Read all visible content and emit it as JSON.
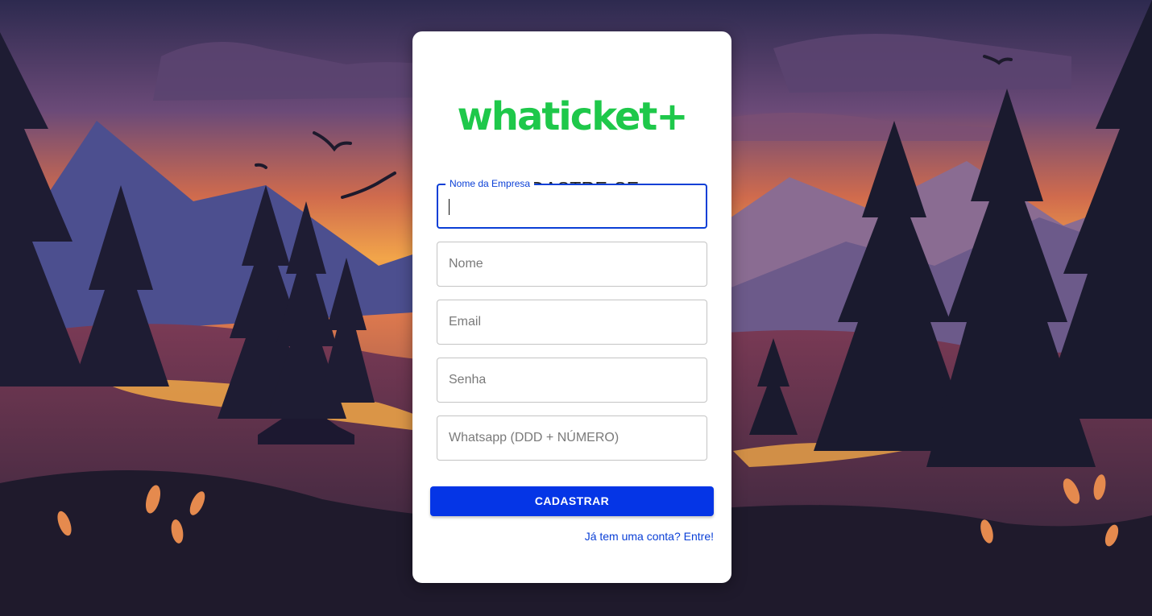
{
  "brand": {
    "logo_text": "whaticket+",
    "color": "#1ec84a"
  },
  "form": {
    "title": "CADASTRE-SE",
    "fields": [
      {
        "label": "Nome da Empresa",
        "value": "",
        "focused": true
      },
      {
        "placeholder": "Nome",
        "value": ""
      },
      {
        "placeholder": "Email",
        "value": ""
      },
      {
        "placeholder": "Senha",
        "value": ""
      },
      {
        "placeholder": "Whatsapp (DDD + NÚMERO)",
        "value": ""
      }
    ],
    "submit_label": "CADASTRAR",
    "login_link": "Já tem uma conta? Entre!"
  },
  "colors": {
    "accent": "#0535e6",
    "link": "#0a3fd6"
  }
}
